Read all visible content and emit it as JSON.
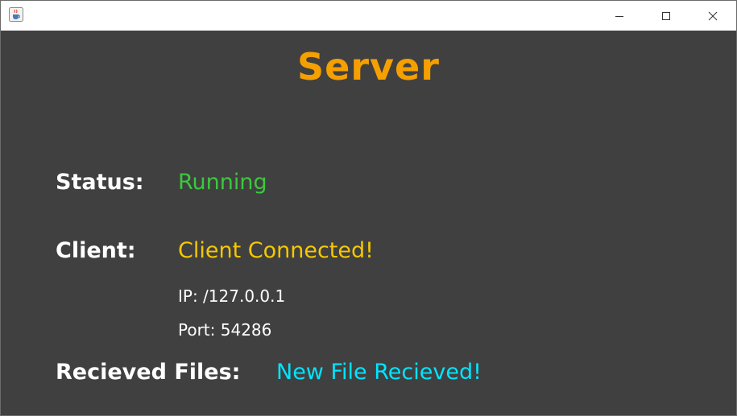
{
  "window": {
    "icons": {
      "app": "java-cup-icon",
      "minimize": "minimize-icon",
      "maximize": "maximize-icon",
      "close": "close-icon"
    }
  },
  "main": {
    "title": "Server",
    "status": {
      "label": "Status:",
      "value": "Running"
    },
    "client": {
      "label": "Client:",
      "value": "Client Connected!",
      "ip": "IP: /127.0.0.1",
      "port": "Port: 54286"
    },
    "files": {
      "label": "Recieved Files:",
      "value": "New File Recieved!"
    }
  },
  "colors": {
    "background": "#404040",
    "title": "#f5a000",
    "status": "#3cc83c",
    "client": "#f5c800",
    "files": "#00e5ff",
    "label": "#ffffff"
  }
}
